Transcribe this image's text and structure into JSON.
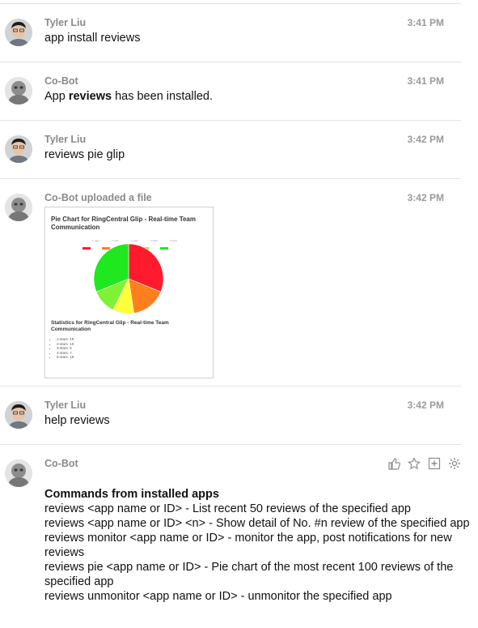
{
  "messages": [
    {
      "author": "Tyler Liu",
      "time": "3:41 PM",
      "text": "app install reviews"
    },
    {
      "author": "Co-Bot",
      "time": "3:41 PM",
      "text_pre": "App ",
      "text_bold": "reviews",
      "text_post": " has been installed."
    },
    {
      "author": "Tyler Liu",
      "time": "3:42 PM",
      "text": "reviews pie glip"
    },
    {
      "author": "Co-Bot uploaded a file",
      "time": "3:42 PM"
    },
    {
      "author": "Tyler Liu",
      "time": "3:42 PM",
      "text": "help reviews"
    },
    {
      "author": "Co-Bot"
    }
  ],
  "attachment": {
    "chart_title": "Pie Chart for RingCentral Glip - Real-time Team Communication",
    "stats_title": "Statistics for RingCentral Glip - Real-time Team Communication",
    "legend_labels": [
      "1 stars",
      "2 stars",
      "3 stars",
      "4 stars",
      "5 stars"
    ],
    "stats_items": [
      "1-stars: 19",
      "2-stars: 10",
      "3-stars: 6",
      "4-stars: 7",
      "5-stars: 19"
    ]
  },
  "chart_data": {
    "type": "pie",
    "categories": [
      "1 stars",
      "2 stars",
      "3 stars",
      "4 stars",
      "5 stars"
    ],
    "values": [
      19,
      10,
      6,
      7,
      19
    ],
    "colors": [
      "#ff1a2e",
      "#ff7f1e",
      "#ffff3a",
      "#7ff236",
      "#1fe81f"
    ]
  },
  "help": {
    "heading": "Commands from installed apps",
    "lines": [
      "reviews <app name or ID> - List recent 50 reviews of the specified app",
      "reviews <app name or ID> <n> - Show detail of No. #n review of the specified app",
      "reviews monitor <app name or ID> - monitor the app, post notifications for new reviews",
      "reviews pie <app name or ID> - Pie chart of the most recent 100 reviews of the specified app",
      "reviews unmonitor <app name or ID> - unmonitor the specified app"
    ]
  },
  "actions": [
    "like-icon",
    "star-icon",
    "add-icon",
    "gear-icon"
  ]
}
